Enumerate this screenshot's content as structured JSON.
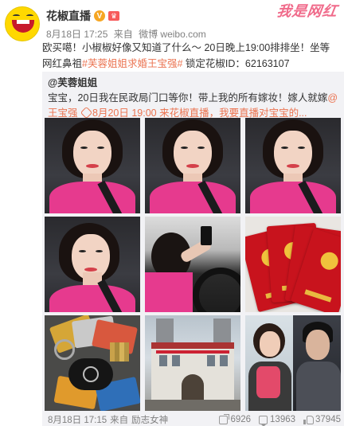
{
  "watermark": "我是网红",
  "author": {
    "name": "花椒直播",
    "verified_badge": "V",
    "level_badge": "♛"
  },
  "meta": {
    "time": "8月18日 17:25",
    "source_prefix": "来自",
    "source": "微博 weibo.com"
  },
  "post": {
    "line1": "欧买噶！小椒椒好像又知道了什么～ 20日晚上19:00排排坐！坐等网红",
    "line2_a": "鼻祖",
    "hashtag": "#芙蓉姐姐求婚王宝强#",
    "line2_b": " 锁定花椒ID：62163107"
  },
  "repost": {
    "user": "@芙蓉姐姐",
    "text_a": "宝宝，20日我在民政局门口等你！带上我的所有嫁妆！嫁人就嫁",
    "mention": "@王宝强",
    "event": "8月20日 19:00 来花椒直播，我要直播对宝宝的..."
  },
  "photos": [
    {
      "label": "selfie-1"
    },
    {
      "label": "selfie-2"
    },
    {
      "label": "selfie-3"
    },
    {
      "label": "selfie-4"
    },
    {
      "label": "driving"
    },
    {
      "label": "marriage-certificates"
    },
    {
      "label": "cards-and-key"
    },
    {
      "label": "civil-affairs-building"
    },
    {
      "label": "two-portraits"
    }
  ],
  "footer": {
    "time": "8月18日 17:15",
    "source_prefix": "来自",
    "source": "励志女神",
    "shares": "6926",
    "comments": "13963",
    "likes": "37945"
  },
  "colors": {
    "link": "#eb7350",
    "repost_bg": "#f2f2f5",
    "muted": "#808080"
  }
}
